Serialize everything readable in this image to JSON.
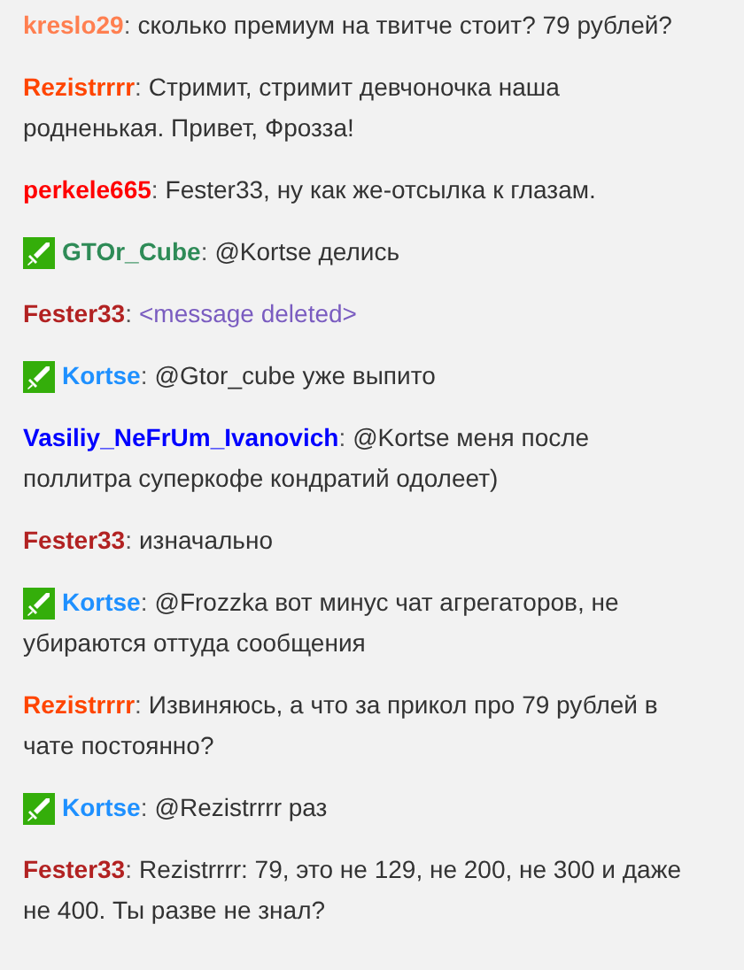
{
  "messages": [
    {
      "user": "kreslo29",
      "color": "#ff7f50",
      "badge": false,
      "separator": ":",
      "text": "сколько премиум на твитче стоит? 79 рублей?",
      "deleted": false
    },
    {
      "user": "Rezistrrrr",
      "color": "#ff4500",
      "badge": false,
      "separator": ":",
      "text": "Стримит, стримит девчоночка наша родненькая. Привет, Фрозза!",
      "deleted": false
    },
    {
      "user": "perkele665",
      "color": "#ff0000",
      "badge": false,
      "separator": ":",
      "text": "Fester33, ну как же-отсылка к глазам.",
      "deleted": false
    },
    {
      "user": "GTOr_Cube",
      "color": "#2e8b57",
      "badge": true,
      "separator": ":",
      "text": "@Kortse делись",
      "deleted": false
    },
    {
      "user": "Fester33",
      "color": "#b22222",
      "badge": false,
      "separator": ":",
      "text": "<message deleted>",
      "deleted": true
    },
    {
      "user": "Kortse",
      "color": "#1e90ff",
      "badge": true,
      "separator": ":",
      "text": "@Gtor_cube уже выпито",
      "deleted": false
    },
    {
      "user": "Vasiliy_NeFrUm_Ivanovich",
      "color": "#0000ff",
      "badge": false,
      "separator": ":",
      "text": "@Kortse меня после поллитра суперкофе кондратий одолеет)",
      "deleted": false
    },
    {
      "user": "Fester33",
      "color": "#b22222",
      "badge": false,
      "separator": ":",
      "text": "изначально",
      "deleted": false
    },
    {
      "user": "Kortse",
      "color": "#1e90ff",
      "badge": true,
      "separator": ":",
      "text": "@Frozzka вот минус чат агрегаторов, не убираются оттуда сообщения",
      "deleted": false
    },
    {
      "user": "Rezistrrrr",
      "color": "#ff4500",
      "badge": false,
      "separator": ":",
      "text": "Извиняюсь, а что за прикол про 79 рублей в чате постоянно?",
      "deleted": false
    },
    {
      "user": "Kortse",
      "color": "#1e90ff",
      "badge": true,
      "separator": ":",
      "text": "@Rezistrrrr раз",
      "deleted": false
    },
    {
      "user": "Fester33",
      "color": "#b22222",
      "badge": false,
      "separator": ":",
      "text": "Rezistrrrr: 79, это не 129, не 200, не 300 и даже не 400. Ты разве не знал?",
      "deleted": false
    }
  ]
}
